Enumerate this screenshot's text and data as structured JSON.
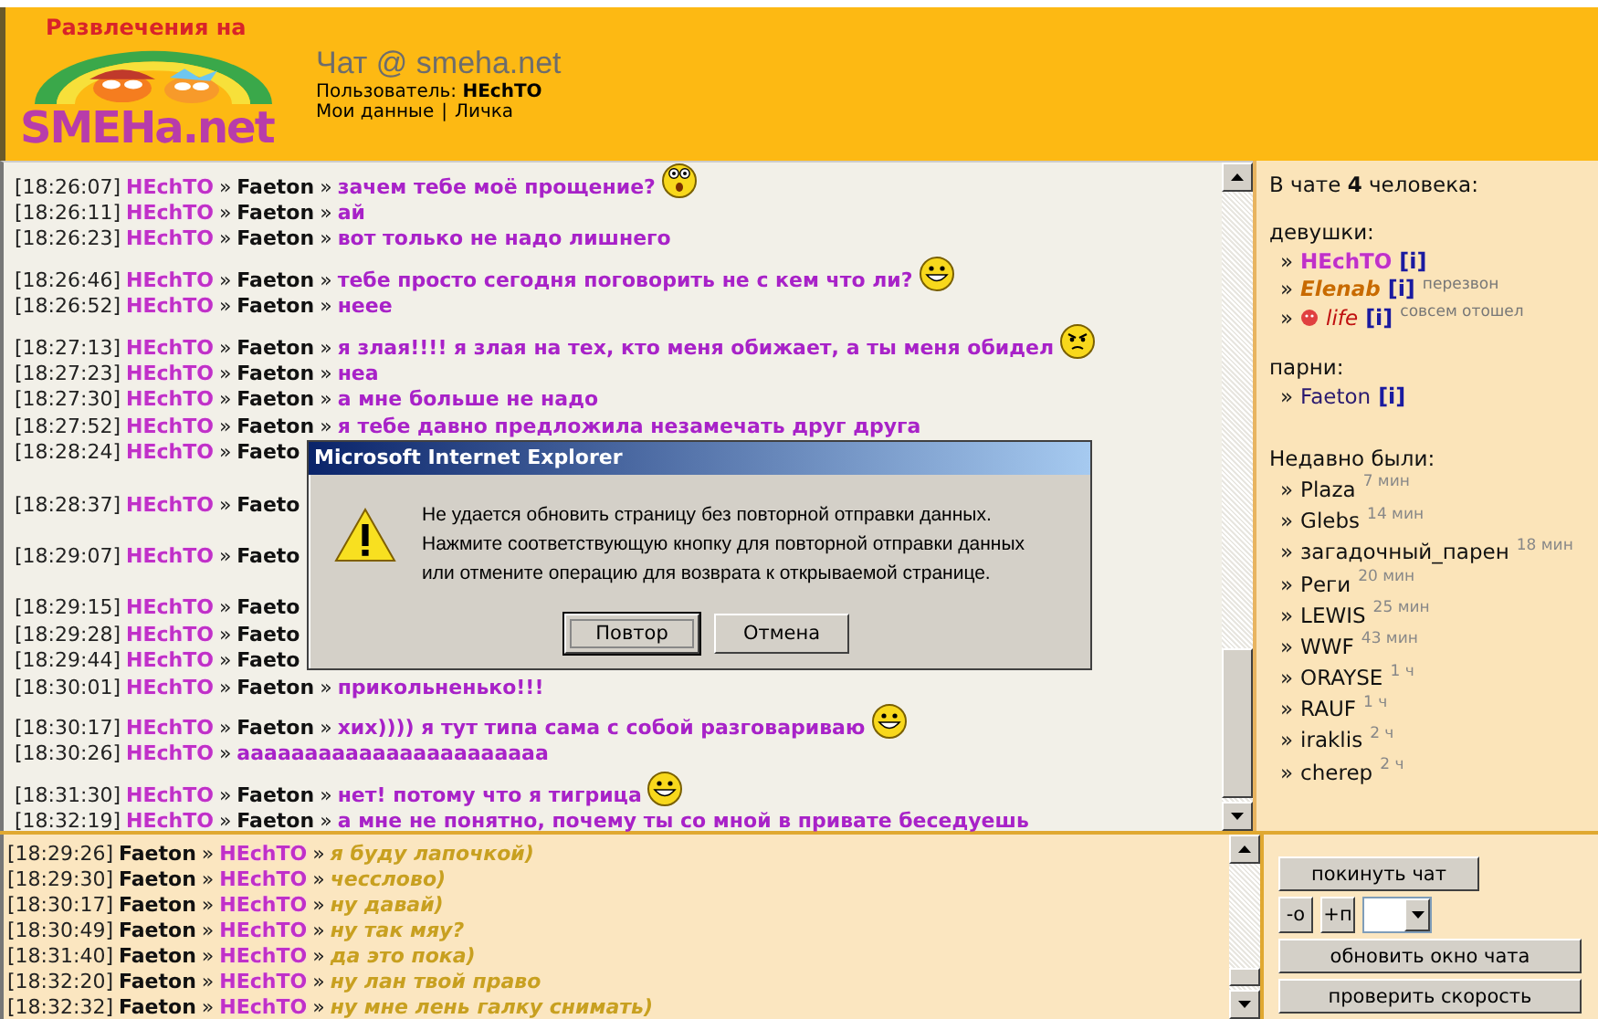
{
  "header": {
    "logo_top": "Развлечения на",
    "logo_bottom": "SMEHa.net",
    "title": "Чат @ smeha.net",
    "user_line": "Пользователь: **HEchTO**",
    "links": [
      "Мои данные",
      "Личка"
    ],
    "link_separator": "|"
  },
  "chat": [
    {
      "lines": [
        {
          "time": "[18:26:07]",
          "nick": "HEchTO",
          "to": "Faeton",
          "text": "зачем тебе моё прощение?",
          "smiley": {
            "kind": "surprised"
          }
        },
        {
          "time": "[18:26:11]",
          "nick": "HEchTO",
          "to": "Faeton",
          "text": "ай"
        },
        {
          "time": "[18:26:23]",
          "nick": "HEchTO",
          "to": "Faeton",
          "text": "вот только не надо лишнего"
        }
      ]
    },
    {
      "lines": [
        {
          "time": "[18:26:46]",
          "nick": "HEchTO",
          "to": "Faeton",
          "text": "тебе просто сегодня поговорить не с кем что ли?",
          "smiley": {
            "kind": "grin"
          }
        },
        {
          "time": "[18:26:52]",
          "nick": "HEchTO",
          "to": "Faeton",
          "text": "неее"
        }
      ]
    },
    {
      "lines": [
        {
          "time": "[18:27:13]",
          "nick": "HEchTO",
          "to": "Faeton",
          "text": "я злая!!!! я злая на тех, кто меня обижает, а ты меня обидел",
          "smiley": {
            "kind": "angry"
          }
        },
        {
          "time": "[18:27:23]",
          "nick": "HEchTO",
          "to": "Faeton",
          "text": "неа"
        },
        {
          "time": "[18:27:30]",
          "nick": "HEchTO",
          "to": "Faeton",
          "text": "а мне больше не надо"
        },
        {
          "time": "[18:27:52]",
          "nick": "HEchTO",
          "to": "Faeton",
          "text": "я тебе давно предложила незамечать друг друга"
        },
        {
          "time": "[18:28:24]",
          "nick": "HEchTO",
          "to": "Faeto"
        }
      ]
    },
    {
      "lines": [
        {
          "time": "[18:28:37]",
          "nick": "HEchTO",
          "to": "Faeto"
        }
      ]
    },
    {
      "lines": [
        {
          "time": "[18:29:07]",
          "nick": "HEchTO",
          "to": "Faeto"
        }
      ]
    },
    {
      "lines": [
        {
          "time": "[18:29:15]",
          "nick": "HEchTO",
          "to": "Faeto"
        },
        {
          "time": "[18:29:28]",
          "nick": "HEchTO",
          "to": "Faeto"
        },
        {
          "time": "[18:29:44]",
          "nick": "HEchTO",
          "to": "Faeto"
        },
        {
          "time": "[18:30:01]",
          "nick": "HEchTO",
          "to": "Faeton",
          "text": "прикольненько!!!"
        }
      ]
    },
    {
      "lines": [
        {
          "time": "[18:30:17]",
          "nick": "HEchTO",
          "to": "Faeton",
          "text": "хих)))) я тут типа сама с собой разговариваю",
          "smiley": {
            "kind": "grin"
          }
        },
        {
          "time": "[18:30:26]",
          "nick": "HEchTO",
          "text": "ааааааааааааааааааааааа"
        }
      ]
    },
    {
      "lines": [
        {
          "time": "[18:31:30]",
          "nick": "HEchTO",
          "to": "Faeton",
          "text": "нет! потому что я тигрица",
          "smiley": {
            "kind": "grin"
          }
        },
        {
          "time": "[18:32:19]",
          "nick": "HEchTO",
          "to": "Faeton",
          "text": "а мне не понятно, почему ты со мной в привате беседуешь"
        }
      ]
    }
  ],
  "separator": "»",
  "dialog": {
    "title": "Microsoft Internet Explorer",
    "message": "Не удается обновить страницу без повторной отправки данных. Нажмите соответствующую кнопку для повторной отправки данных или отмените операцию для возврата к открываемой странице.",
    "buttons": [
      {
        "label": "Повтор",
        "selected": true
      },
      {
        "label": "Отмена",
        "selected": false
      }
    ]
  },
  "online": {
    "summary": "В чате **4** человека:",
    "groups": [
      {
        "title": "девушки:",
        "users": [
          {
            "name": "HEchTO",
            "kind": "glow-pink",
            "info": "[i]"
          },
          {
            "name": "Elenab",
            "kind": "glow-orange",
            "info": "[i]",
            "note": "перезвон"
          },
          {
            "name": "life",
            "kind": "red-smiley",
            "info": "[i]",
            "note": "совсем отошел"
          }
        ]
      },
      {
        "title": "парни:",
        "users": [
          {
            "name": "Faeton",
            "kind": "plain",
            "info": "[i]"
          }
        ]
      }
    ]
  },
  "recent": {
    "title": "Недавно были:",
    "users": [
      {
        "name": "Plaza",
        "ago": "7 мин"
      },
      {
        "name": "Glebs",
        "ago": "14 мин"
      },
      {
        "name": "загадочный_парен",
        "ago": "18 мин"
      },
      {
        "name": "Реги",
        "ago": "20 мин"
      },
      {
        "name": "LEWIS",
        "ago": "25 мин"
      },
      {
        "name": "WWF",
        "ago": "43 мин"
      },
      {
        "name": "ORAYSE",
        "ago": "1 ч"
      },
      {
        "name": "RAUF",
        "ago": "1 ч"
      },
      {
        "name": "iraklis",
        "ago": "2 ч"
      },
      {
        "name": "cherep",
        "ago": "2 ч"
      }
    ]
  },
  "private": [
    {
      "time": "[18:29:26]",
      "from": "Faeton",
      "nick": "HEchTO",
      "text": "я буду лапочкой)"
    },
    {
      "time": "[18:29:30]",
      "from": "Faeton",
      "nick": "HEchTO",
      "text": "чесслово)"
    },
    {
      "time": "[18:30:17]",
      "from": "Faeton",
      "nick": "HEchTO",
      "text": "ну давай)"
    },
    {
      "time": "[18:30:49]",
      "from": "Faeton",
      "nick": "HEchTO",
      "text": "ну так мяу?"
    },
    {
      "time": "[18:31:40]",
      "from": "Faeton",
      "nick": "HEchTO",
      "text": "да это пока)"
    },
    {
      "time": "[18:32:20]",
      "from": "Faeton",
      "nick": "HEchTO",
      "text": "ну лан твой право"
    },
    {
      "time": "[18:32:32]",
      "from": "Faeton",
      "nick": "HEchTO",
      "text": "ну мне лень галку снимать)"
    }
  ],
  "controls": {
    "leave": "покинуть чат",
    "minus": "-о",
    "plus": "+п",
    "refresh": "обновить окно чата",
    "speed": "проверить скорость"
  }
}
